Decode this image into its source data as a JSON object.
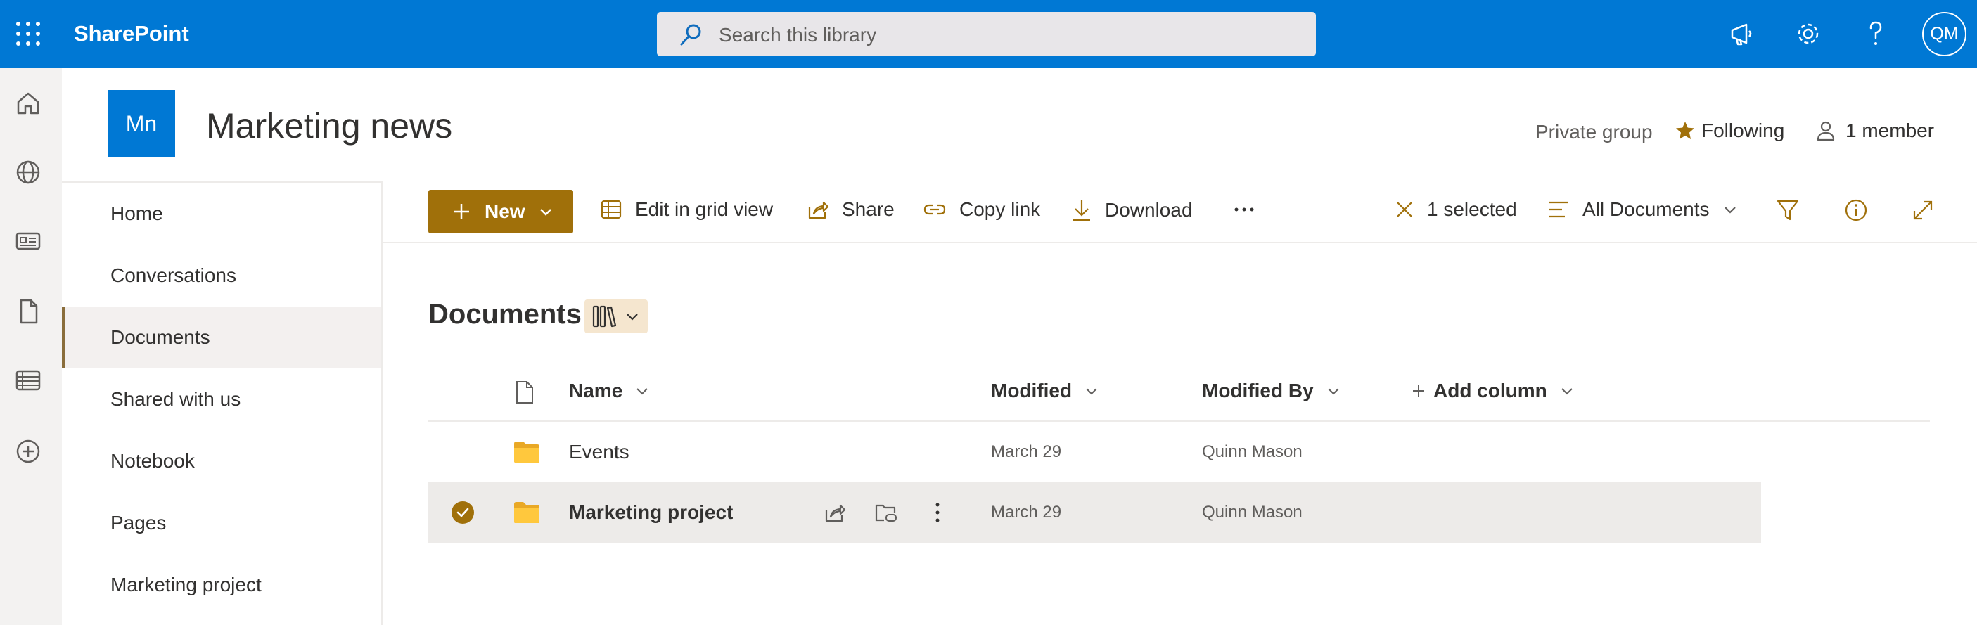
{
  "suitebar": {
    "brand": "SharePoint",
    "search_placeholder": "Search this library",
    "avatar_initials": "QM"
  },
  "site": {
    "logo_initials": "Mn",
    "title": "Marketing news",
    "privacy": "Private group",
    "following_label": "Following",
    "members_label": "1 member"
  },
  "leftnav": {
    "items": [
      {
        "label": "Home"
      },
      {
        "label": "Conversations"
      },
      {
        "label": "Documents"
      },
      {
        "label": "Shared with us"
      },
      {
        "label": "Notebook"
      },
      {
        "label": "Pages"
      },
      {
        "label": "Marketing project"
      }
    ],
    "active_index": 2
  },
  "commandbar": {
    "new_label": "New",
    "edit_grid_label": "Edit in grid view",
    "share_label": "Share",
    "copy_link_label": "Copy link",
    "download_label": "Download",
    "selected_label": "1 selected",
    "view_label": "All Documents"
  },
  "library": {
    "title": "Documents",
    "columns": {
      "name": "Name",
      "modified": "Modified",
      "modified_by": "Modified By",
      "add_column": "Add column"
    },
    "rows": [
      {
        "name": "Events",
        "modified": "March 29",
        "modified_by": "Quinn Mason",
        "selected": false
      },
      {
        "name": "Marketing project",
        "modified": "March 29",
        "modified_by": "Quinn Mason",
        "selected": true
      }
    ]
  },
  "colors": {
    "suitebar": "#0078d4",
    "accent": "#a0700a",
    "folder": "#ffc83d",
    "selected_row": "#edebe9"
  }
}
